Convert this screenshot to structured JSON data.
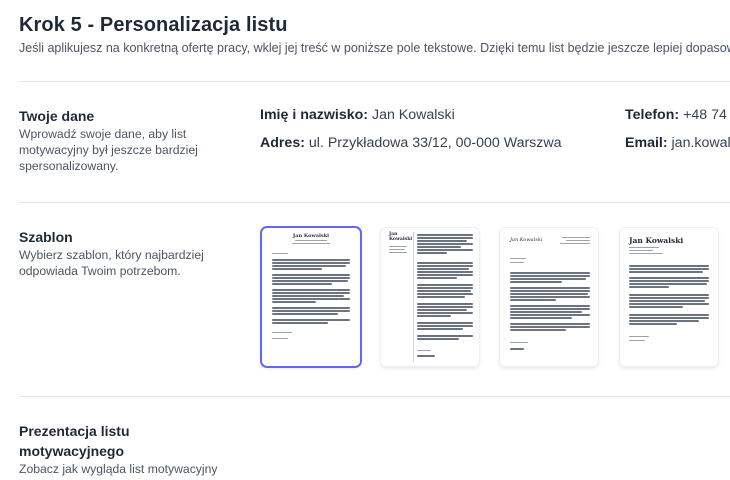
{
  "header": {
    "title": "Krok 5 - Personalizacja listu",
    "subtitle": "Jeśli aplikujesz na konkretną ofertę pracy, wklej jej treść w poniższe pole tekstowe. Dzięki temu list będzie jeszcze lepiej dopasowany"
  },
  "personal": {
    "title": "Twoje dane",
    "desc": "Wprowadź swoje dane, aby list motywacyjny był jeszcze bardziej spersonalizowany.",
    "name_label": "Imię i nazwisko:",
    "name_value": "Jan Kowalski",
    "address_label": "Adres:",
    "address_value": "ul. Przykładowa 33/12, 00-000 Warszwa",
    "phone_label": "Telefon:",
    "phone_value": "+48 74",
    "email_label": "Email:",
    "email_value": "jan.kowal"
  },
  "template": {
    "title": "Szablon",
    "desc": "Wybierz szablon, który najbardziej odpowiada Twoim potrzebom.",
    "options": [
      {
        "name": "Jan Kowalski",
        "selected": true
      },
      {
        "name": "Jan Kowalski",
        "selected": false
      },
      {
        "name": "Jan Kowalski",
        "selected": false
      },
      {
        "name": "Jan Kowalski",
        "selected": false
      }
    ]
  },
  "presentation": {
    "title": "Prezentacja listu motywacyjnego",
    "desc": "Zobacz jak wygląda list motywacyjny"
  },
  "colors": {
    "accent": "#6366f1",
    "text": "#1f2937",
    "muted": "#4b5563",
    "divider": "#e5e7eb"
  }
}
